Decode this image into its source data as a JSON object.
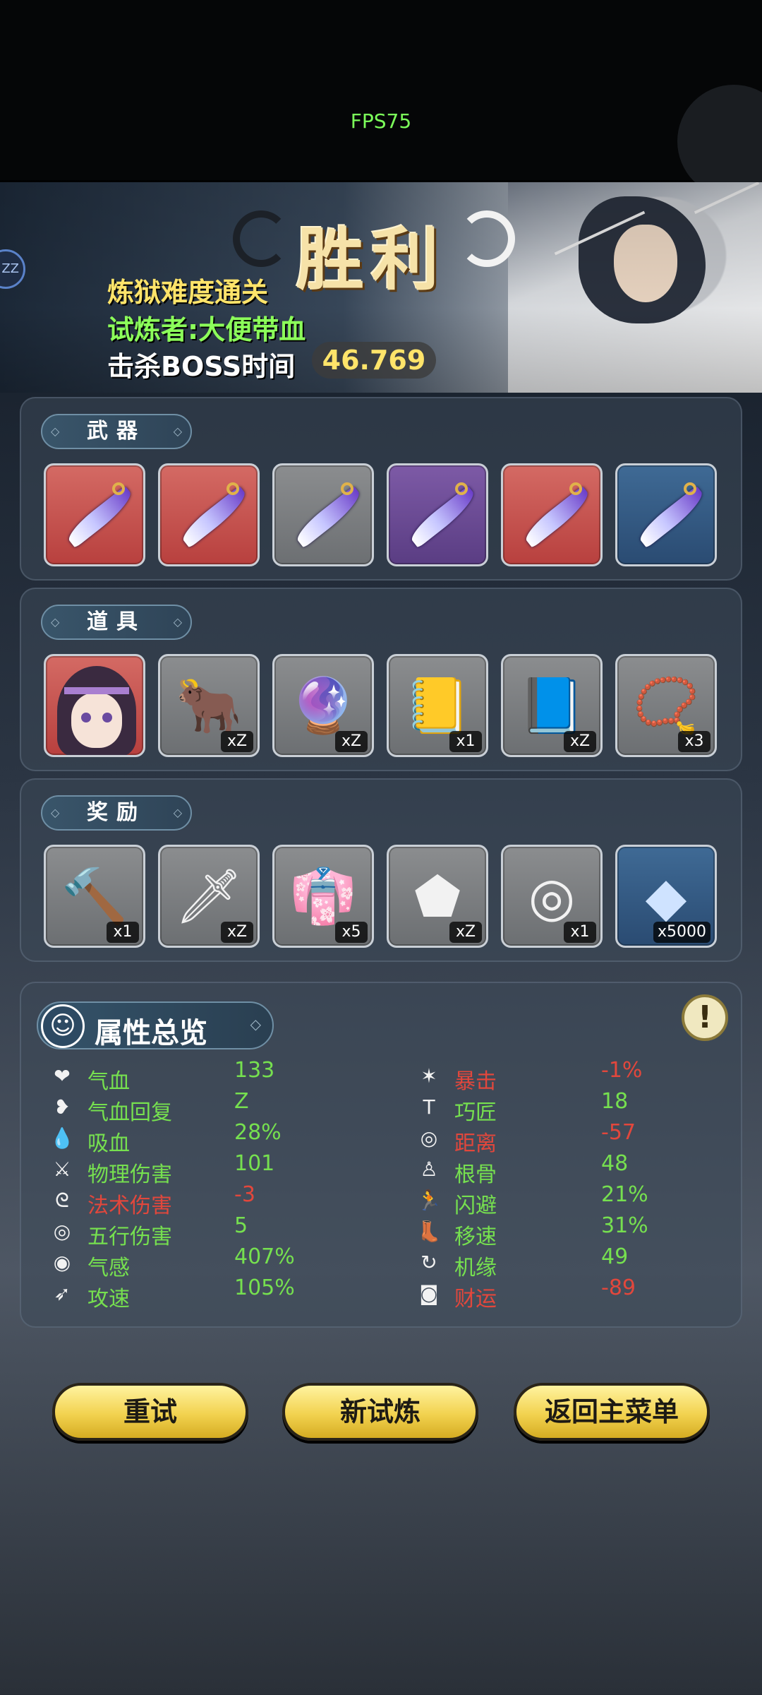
{
  "status": {
    "fps": "FPS75"
  },
  "banner": {
    "title": "胜利",
    "difficulty": "炼狱难度通关",
    "trialer": "试炼者:大便带血",
    "kill_time_label": "击杀BOSS时间",
    "kill_time": "46.769",
    "side_badge": "ZZ"
  },
  "sections": {
    "weapons": {
      "title": "武器"
    },
    "items": {
      "title": "道具"
    },
    "rewards": {
      "title": "奖励"
    },
    "stats": {
      "title": "属性总览",
      "info": "!"
    }
  },
  "weapons": [
    {
      "rarity": "red",
      "icon": "purple-blade-icon"
    },
    {
      "rarity": "red",
      "icon": "purple-blade-icon"
    },
    {
      "rarity": "gray",
      "icon": "purple-blade-icon"
    },
    {
      "rarity": "purple",
      "icon": "purple-blade-icon"
    },
    {
      "rarity": "red",
      "icon": "purple-blade-icon"
    },
    {
      "rarity": "blue",
      "icon": "purple-blade-icon"
    }
  ],
  "items": [
    {
      "icon": "character-portrait-icon",
      "count": ""
    },
    {
      "icon": "bull-mask-icon",
      "count": "xZ"
    },
    {
      "icon": "orb-pedestal-icon",
      "count": "xZ"
    },
    {
      "icon": "yellow-book-icon",
      "count": "x1"
    },
    {
      "icon": "purple-book-icon",
      "count": "xZ"
    },
    {
      "icon": "prayer-beads-icon",
      "count": "x3"
    }
  ],
  "rewards": [
    {
      "icon": "mace-icon",
      "glyph": "🔨",
      "count": "x1"
    },
    {
      "icon": "sword-icon",
      "glyph": "🗡",
      "count": "xZ"
    },
    {
      "icon": "robe-icon",
      "glyph": "👘",
      "count": "x5"
    },
    {
      "icon": "stone-icon",
      "glyph": "⬟",
      "count": "xZ"
    },
    {
      "icon": "ring-belt-icon",
      "glyph": "◎",
      "count": "x1"
    },
    {
      "icon": "crystal-icon",
      "glyph": "◆",
      "count": "x5000"
    }
  ],
  "stats_left": [
    {
      "icon": "heart-icon",
      "glyph": "❤",
      "name": "气血",
      "value": "133",
      "tone": "good"
    },
    {
      "icon": "heart-regen-icon",
      "glyph": "❥",
      "name": "气血回复",
      "value": "Z",
      "tone": "good"
    },
    {
      "icon": "blood-drop-icon",
      "glyph": "💧",
      "name": "吸血",
      "value": "28%",
      "tone": "good"
    },
    {
      "icon": "physical-damage-icon",
      "glyph": "⚔",
      "name": "物理伤害",
      "value": "101",
      "tone": "good"
    },
    {
      "icon": "spell-damage-icon",
      "glyph": "ᘓ",
      "name": "法术伤害",
      "value": "-3",
      "tone": "bad"
    },
    {
      "icon": "element-damage-icon",
      "glyph": "◎",
      "name": "五行伤害",
      "value": "5",
      "tone": "good"
    },
    {
      "icon": "qi-sense-icon",
      "glyph": "◉",
      "name": "气感",
      "value": "407%",
      "tone": "good"
    },
    {
      "icon": "attack-speed-icon",
      "glyph": "➶",
      "name": "攻速",
      "value": "105%",
      "tone": "good"
    }
  ],
  "stats_right": [
    {
      "icon": "crit-icon",
      "glyph": "✶",
      "name": "暴击",
      "value": "-1%",
      "tone": "bad"
    },
    {
      "icon": "craft-icon",
      "glyph": "T",
      "name": "巧匠",
      "value": "18",
      "tone": "good"
    },
    {
      "icon": "range-icon",
      "glyph": "◎",
      "name": "距离",
      "value": "-57",
      "tone": "bad"
    },
    {
      "icon": "bone-icon",
      "glyph": "♙",
      "name": "根骨",
      "value": "48",
      "tone": "good"
    },
    {
      "icon": "dodge-icon",
      "glyph": "🏃",
      "name": "闪避",
      "value": "21%",
      "tone": "good"
    },
    {
      "icon": "move-speed-icon",
      "glyph": "👢",
      "name": "移速",
      "value": "31%",
      "tone": "good"
    },
    {
      "icon": "luck-icon",
      "glyph": "↻",
      "name": "机缘",
      "value": "49",
      "tone": "good"
    },
    {
      "icon": "wealth-icon",
      "glyph": "◙",
      "name": "财运",
      "value": "-89",
      "tone": "bad"
    }
  ],
  "buttons": {
    "retry": "重试",
    "new_trial": "新试炼",
    "main_menu": "返回主菜单"
  },
  "colors": {
    "positive": "#76e04f",
    "negative": "#e2473c",
    "title_gold": "#f6e2a8",
    "button_gold": "#f2d24f"
  }
}
